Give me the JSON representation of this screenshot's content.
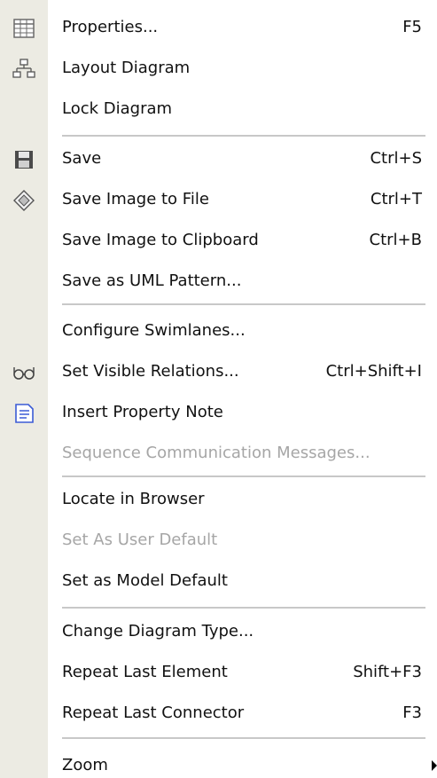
{
  "menu": {
    "items": [
      {
        "label": "Properties...",
        "shortcut": "F5",
        "icon": "properties-grid-icon",
        "enabled": true
      },
      {
        "label": "Layout Diagram",
        "shortcut": "",
        "icon": "layout-diagram-icon",
        "enabled": true
      },
      {
        "label": "Lock Diagram",
        "shortcut": "",
        "icon": "",
        "enabled": true
      },
      {
        "label": "Save",
        "shortcut": "Ctrl+S",
        "icon": "floppy-disk-icon",
        "enabled": true
      },
      {
        "label": "Save Image to File",
        "shortcut": "Ctrl+T",
        "icon": "save-image-icon",
        "enabled": true
      },
      {
        "label": "Save Image to Clipboard",
        "shortcut": "Ctrl+B",
        "icon": "",
        "enabled": true
      },
      {
        "label": "Save as UML Pattern...",
        "shortcut": "",
        "icon": "",
        "enabled": true
      },
      {
        "label": "Configure Swimlanes...",
        "shortcut": "",
        "icon": "",
        "enabled": true
      },
      {
        "label": "Set Visible Relations...",
        "shortcut": "Ctrl+Shift+I",
        "icon": "glasses-icon",
        "enabled": true
      },
      {
        "label": "Insert Property Note",
        "shortcut": "",
        "icon": "note-icon",
        "enabled": true
      },
      {
        "label": "Sequence Communication Messages...",
        "shortcut": "",
        "icon": "",
        "enabled": false
      },
      {
        "label": "Locate in Browser",
        "shortcut": "",
        "icon": "",
        "enabled": true
      },
      {
        "label": "Set As User Default",
        "shortcut": "",
        "icon": "",
        "enabled": false
      },
      {
        "label": "Set as Model Default",
        "shortcut": "",
        "icon": "",
        "enabled": true
      },
      {
        "label": "Change Diagram Type...",
        "shortcut": "",
        "icon": "",
        "enabled": true
      },
      {
        "label": "Repeat Last Element",
        "shortcut": "Shift+F3",
        "icon": "",
        "enabled": true
      },
      {
        "label": "Repeat Last Connector",
        "shortcut": "F3",
        "icon": "",
        "enabled": true
      },
      {
        "label": "Zoom",
        "shortcut": "",
        "icon": "submenu-arrow-icon",
        "enabled": true
      }
    ]
  },
  "colors": {
    "gutter": "#ecebe3",
    "text": "#111111",
    "disabled_text": "#a6a6a6",
    "separator": "#c8c8c8",
    "note_icon": "#3b5bd6"
  }
}
